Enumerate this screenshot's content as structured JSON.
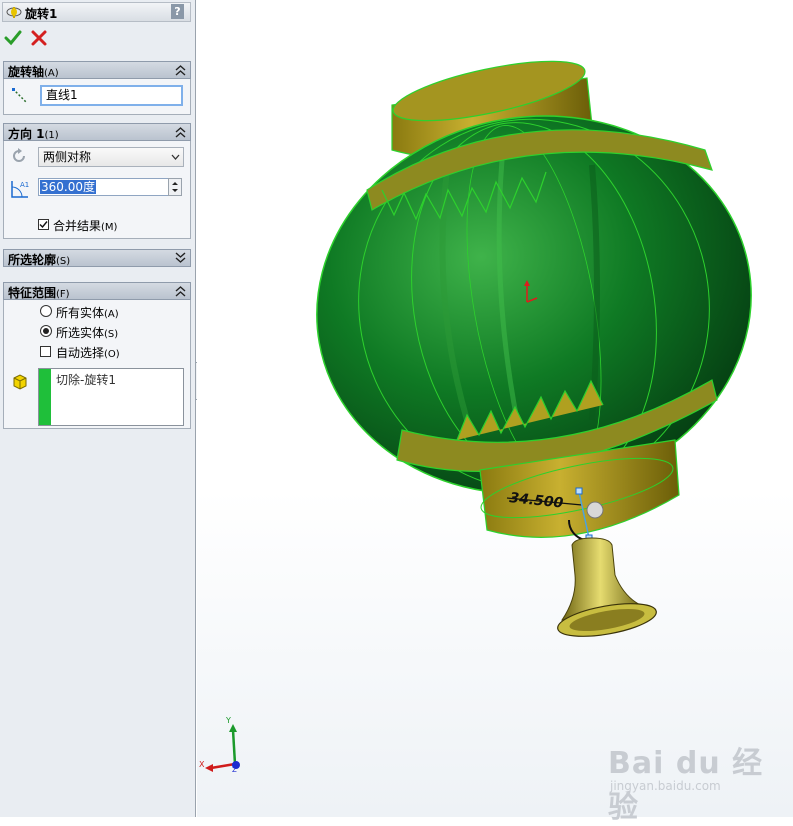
{
  "feature": {
    "title": "旋转1",
    "help": "?"
  },
  "icons": {
    "ok": "check-icon",
    "cancel": "x-icon",
    "accent_ok": "#2a9d2a",
    "accent_cancel": "#d42020",
    "list_bar_color": "#1fbf3a"
  },
  "axis_section": {
    "title": "旋转轴",
    "hotkey": "(A)",
    "value": "直线1"
  },
  "direction_section": {
    "title": "方向 1",
    "hotkey": "(1)",
    "type_option": "两侧对称",
    "angle_value": "360.00度",
    "merge_label": "合并结果",
    "merge_hotkey": "(M)",
    "merge_checked": true
  },
  "contour_section": {
    "title": "所选轮廓",
    "hotkey": "(S)"
  },
  "scope_section": {
    "title": "特征范围",
    "hotkey": "(F)",
    "options": [
      {
        "label": "所有实体",
        "hotkey": "(A)",
        "selected": false
      },
      {
        "label": "所选实体",
        "hotkey": "(S)",
        "selected": true
      }
    ],
    "auto_select_label": "自动选择",
    "auto_select_hotkey": "(O)",
    "auto_select_checked": false,
    "bodies": [
      "切除-旋转1"
    ]
  },
  "viewport": {
    "dimension_label": "34.500",
    "triad": {
      "x": "X",
      "y": "Y",
      "z": "Z"
    },
    "watermark": "Bai du 经验",
    "watermark_url": "jingyan.baidu.com"
  }
}
